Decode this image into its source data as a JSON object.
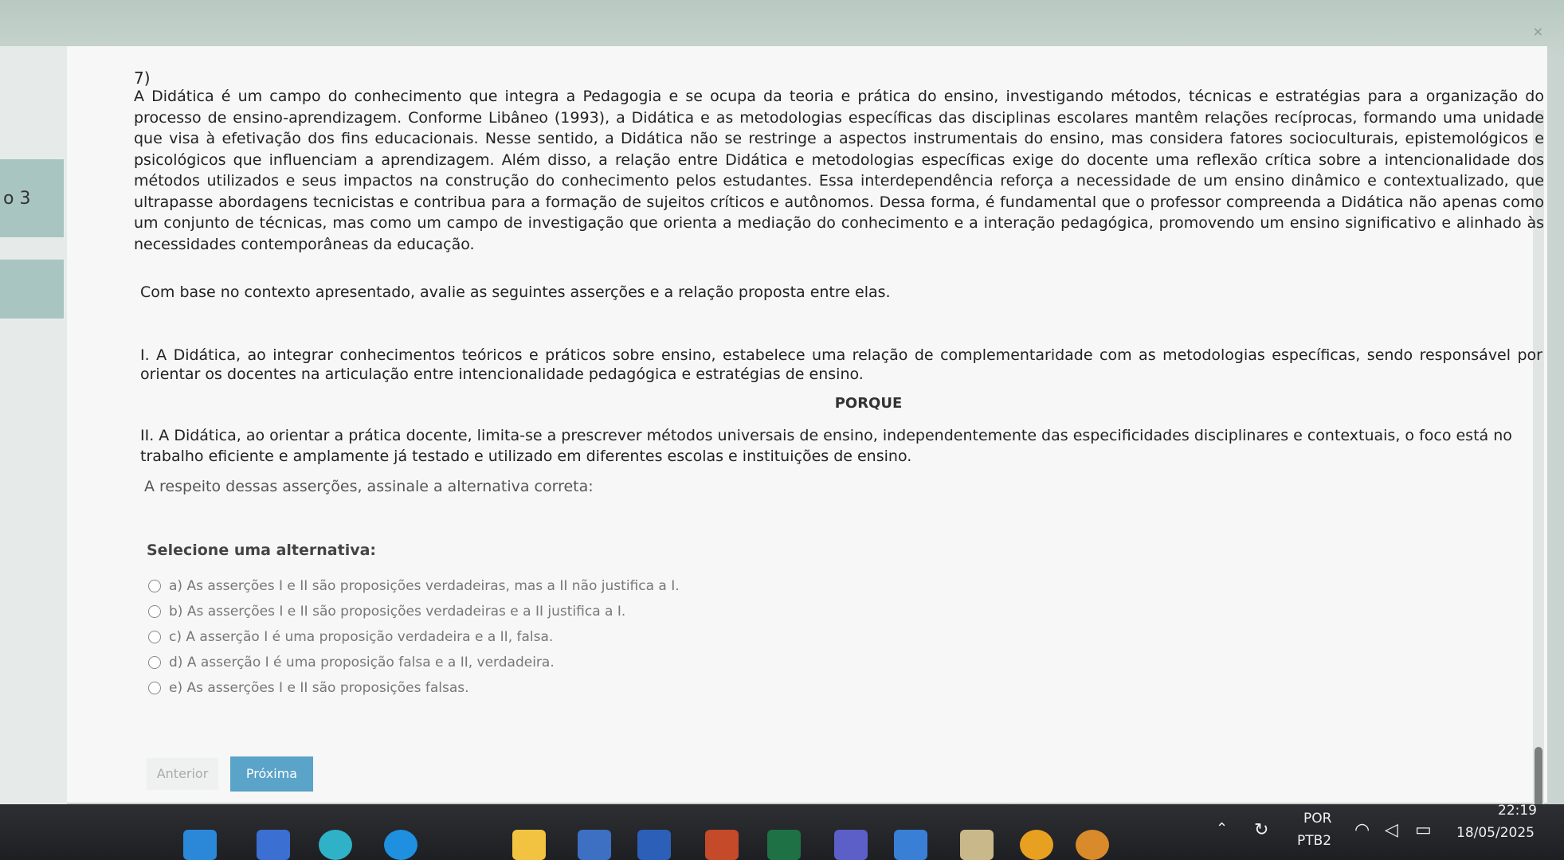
{
  "window": {
    "close_glyph": "×"
  },
  "sidebar": {
    "question_indicator": "o 3"
  },
  "question": {
    "number": "7)",
    "paragraph": "A Didática é um campo do conhecimento que integra a Pedagogia e se ocupa da teoria e prática do ensino, investigando métodos, técnicas e estratégias para a organização do processo de ensino-aprendizagem. Conforme Libâneo (1993), a Didática e as metodologias específicas das disciplinas escolares mantêm relações recíprocas, formando uma unidade que visa à efetivação dos fins educacionais. Nesse sentido, a Didática não se restringe a aspectos instrumentais do ensino, mas considera fatores socioculturais, epistemológicos e psicológicos que influenciam a aprendizagem. Além disso, a relação entre Didática e metodologias específicas exige do docente uma reflexão crítica sobre a intencionalidade dos métodos utilizados e seus impactos na construção do conhecimento pelos estudantes. Essa interdependência reforça a necessidade de um ensino dinâmico e contextualizado, que ultrapasse abordagens tecnicistas e contribua para a formação de sujeitos críticos e autônomos. Dessa forma, é fundamental que o professor compreenda a Didática não apenas como um conjunto de técnicas, mas como um campo de investigação que orienta a mediação do conhecimento e a interação pedagógica, promovendo um ensino significativo e alinhado às necessidades contemporâneas da educação.",
    "prompt": "Com base no contexto apresentado, avalie as seguintes asserções e a relação proposta entre elas.",
    "assertion_1": "I. A Didática, ao integrar conhecimentos teóricos e práticos sobre ensino, estabelece uma relação de complementaridade com as metodologias específicas, sendo responsável por orientar os docentes na articulação entre intencionalidade pedagógica e estratégias de ensino.",
    "connector": "PORQUE",
    "assertion_2": "II. A Didática, ao orientar a prática docente, limita-se a prescrever métodos universais de ensino, independentemente das especificidades disciplinares e contextuais, o foco está no trabalho eficiente e amplamente já testado e utilizado em diferentes escolas e instituições de ensino.",
    "instruction": "A respeito dessas asserções, assinale a alternativa correta:",
    "select_label": "Selecione uma alternativa:",
    "options": [
      "a) As asserções I e II são proposições verdadeiras, mas a II não justifica a I.",
      "b) As asserções I e II são proposições verdadeiras e a II justifica a I.",
      "c) A asserção I é uma proposição verdadeira e a II, falsa.",
      "d) A asserção I é uma proposição falsa e a II, verdadeira.",
      "e) As asserções I e II são proposições falsas."
    ]
  },
  "navigation": {
    "previous_label": "Anterior",
    "next_label": "Próxima"
  },
  "taskbar": {
    "language": "POR",
    "layout": "PTB2",
    "time": "22:19",
    "date": "18/05/2025"
  },
  "colors": {
    "accent": "#5aa3c9",
    "sidebar_box": "#a8c5c2",
    "taskbar": "#1e1f22"
  }
}
